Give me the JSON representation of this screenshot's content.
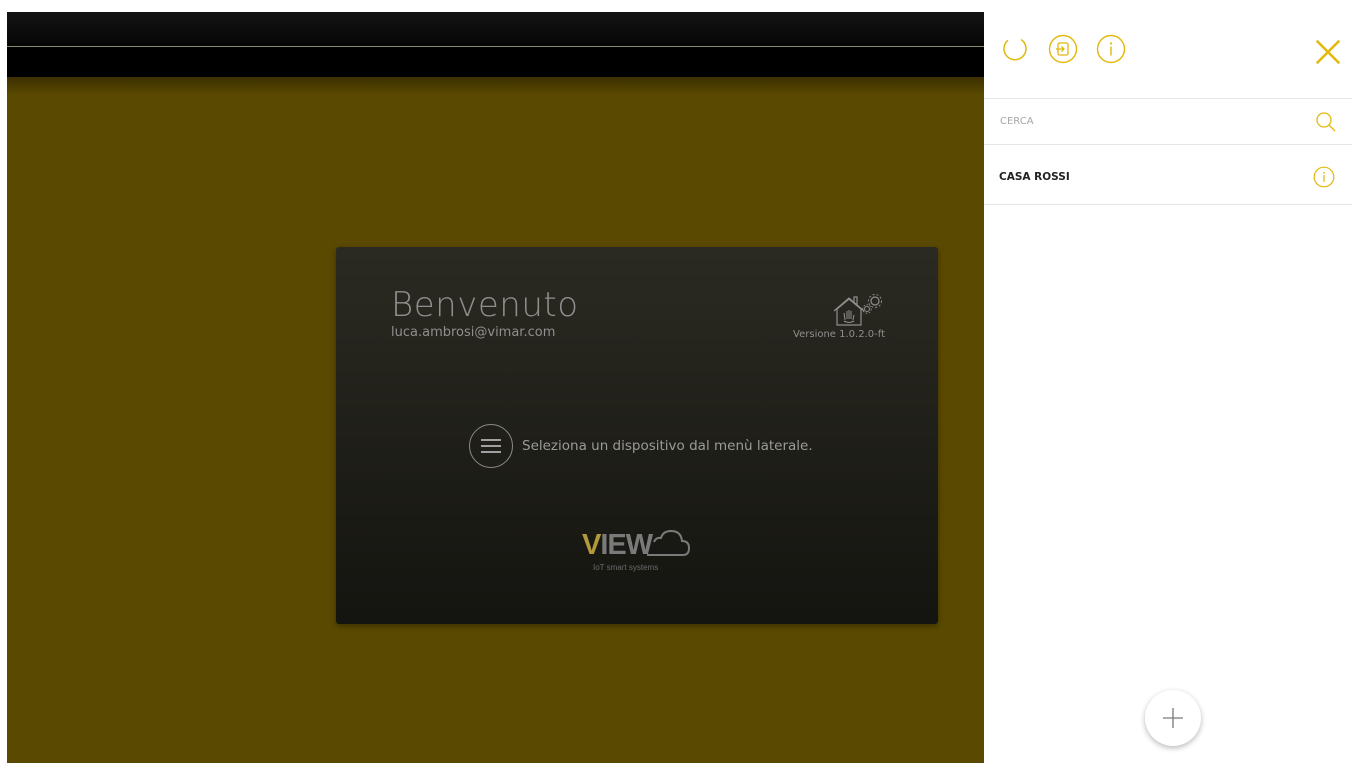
{
  "welcome": {
    "title": "Benvenuto",
    "email": "luca.ambrosi@vimar.com",
    "version": "Versione 1.0.2.0-ft",
    "hint": "Seleziona un dispositivo dal menù laterale."
  },
  "logo": {
    "wordmark_accent": "V",
    "wordmark_rest": "IEW",
    "subtitle": "IoT smart systems"
  },
  "panel": {
    "header_icons": [
      "refresh-icon",
      "logout-icon",
      "info-icon"
    ],
    "close_icon": "close-icon",
    "search": {
      "placeholder": "CERCA",
      "value": ""
    },
    "items": [
      {
        "label": "CASA ROSSI",
        "icon": "info-icon"
      }
    ],
    "add_icon": "plus-icon"
  },
  "colors": {
    "accent": "#e2b80c",
    "stage_background": "#5a4900",
    "card_background": "#1d1c17"
  }
}
